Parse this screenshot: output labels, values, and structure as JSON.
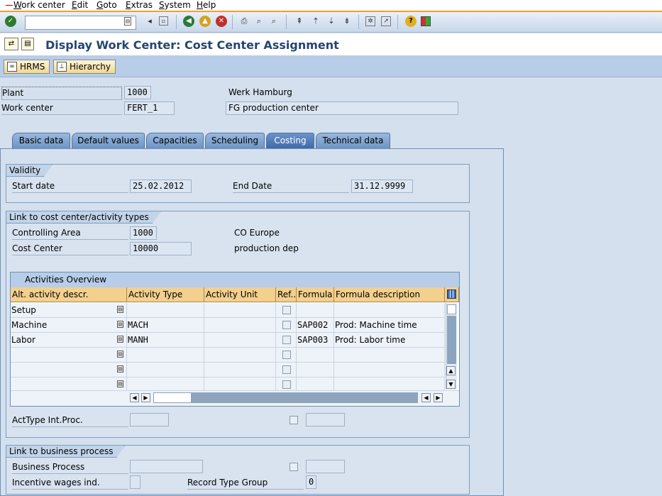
{
  "menu": [
    "Work center",
    "Edit",
    "Goto",
    "Extras",
    "System",
    "Help"
  ],
  "title": "Display Work Center: Cost Center Assignment",
  "app_buttons": {
    "hrms": "HRMS",
    "hierarchy": "Hierarchy"
  },
  "header": {
    "plant_label": "Plant",
    "plant_value": "1000",
    "plant_desc": "Werk Hamburg",
    "workcenter_label": "Work center",
    "workcenter_value": "FERT_1",
    "workcenter_desc": "FG production center"
  },
  "tabs": [
    "Basic data",
    "Default values",
    "Capacities",
    "Scheduling",
    "Costing",
    "Technical data"
  ],
  "active_tab": "Costing",
  "validity": {
    "title": "Validity",
    "start_label": "Start date",
    "start_value": "25.02.2012",
    "end_label": "End Date",
    "end_value": "31.12.9999"
  },
  "link_cc": {
    "title": "Link to cost center/activity types",
    "ca_label": "Controlling Area",
    "ca_value": "1000",
    "ca_desc": "CO Europe",
    "cc_label": "Cost Center",
    "cc_value": "10000",
    "cc_desc": "production dep"
  },
  "activities": {
    "caption": "Activities Overview",
    "columns": [
      "Alt. activity descr.",
      "Activity Type",
      "Activity Unit",
      "Ref...",
      "Formula ...",
      "Formula description"
    ],
    "rows": [
      {
        "desc": "Setup",
        "type": "",
        "unit": "",
        "formula": "",
        "fdesc": ""
      },
      {
        "desc": "Machine",
        "type": "MACH",
        "unit": "",
        "formula": "SAP002",
        "fdesc": "Prod: Machine time"
      },
      {
        "desc": "Labor",
        "type": "MANH",
        "unit": "",
        "formula": "SAP003",
        "fdesc": "Prod: Labor time"
      },
      {
        "desc": "",
        "type": "",
        "unit": "",
        "formula": "",
        "fdesc": ""
      },
      {
        "desc": "",
        "type": "",
        "unit": "",
        "formula": "",
        "fdesc": ""
      },
      {
        "desc": "",
        "type": "",
        "unit": "",
        "formula": "",
        "fdesc": ""
      }
    ]
  },
  "acttype_label": "ActType Int.Proc.",
  "link_bp": {
    "title": "Link to business process",
    "bp_label": "Business Process",
    "incentive_label": "Incentive wages ind.",
    "record_type_label": "Record Type Group",
    "record_type_value": "0"
  }
}
